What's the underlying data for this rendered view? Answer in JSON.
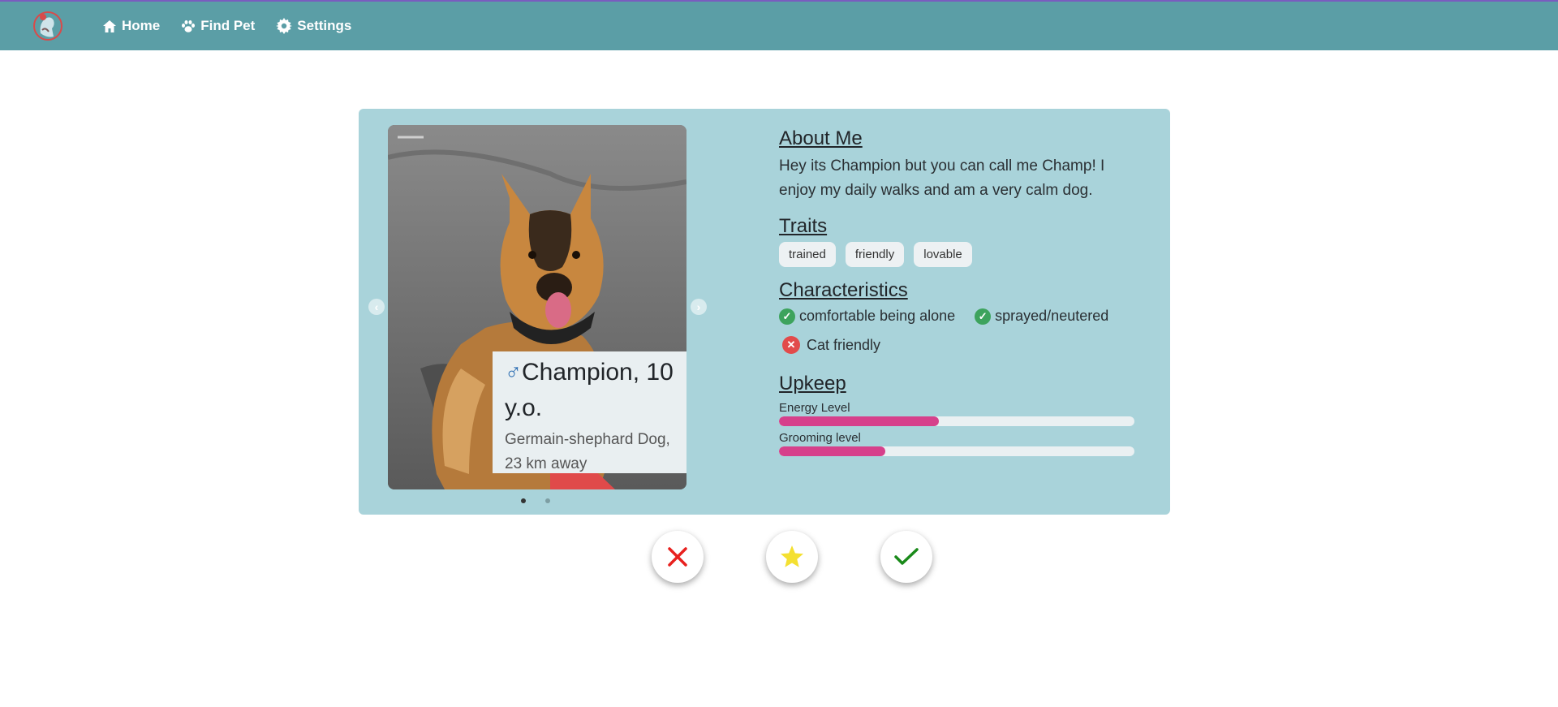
{
  "nav": {
    "items": [
      {
        "label": "Home",
        "icon": "home-icon"
      },
      {
        "label": "Find Pet",
        "icon": "paw-icon"
      },
      {
        "label": "Settings",
        "icon": "gear-icon"
      }
    ]
  },
  "pet": {
    "name_line": "Champion, 10 y.o.",
    "gender_symbol": "♂",
    "breed_distance": "Germain-shephard Dog, 23 km away",
    "carousel": {
      "slides": 2,
      "active": 1
    }
  },
  "about": {
    "title": "About Me",
    "text": "Hey its Champion but you can call me Champ! I enjoy my daily walks and am a very calm dog."
  },
  "traits": {
    "title": "Traits",
    "items": [
      "trained",
      "friendly",
      "lovable"
    ]
  },
  "characteristics": {
    "title": "Characteristics",
    "items": [
      {
        "label": "comfortable being alone",
        "positive": true
      },
      {
        "label": "sprayed/neutered",
        "positive": true
      },
      {
        "label": "Cat friendly",
        "positive": false
      }
    ]
  },
  "upkeep": {
    "title": "Upkeep",
    "energy_label": "Energy Level",
    "energy_value": 0.45,
    "grooming_label": "Grooming level",
    "grooming_value": 0.3
  },
  "colors": {
    "navbar": "#5b9ea6",
    "card": "#a9d3da",
    "bar_fill": "#d6408b",
    "reject": "#e8201e",
    "star": "#f4e031",
    "accept": "#1a8a1a"
  },
  "actions": {
    "reject_icon": "close-icon",
    "favorite_icon": "star-icon",
    "accept_icon": "check-icon"
  }
}
